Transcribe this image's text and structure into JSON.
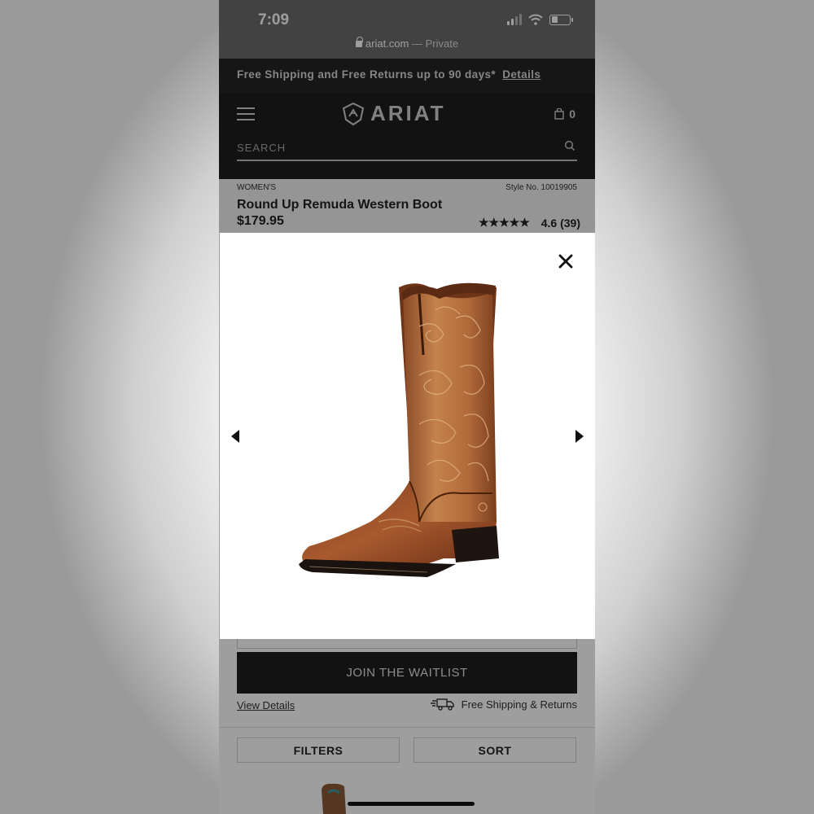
{
  "status_bar": {
    "time": "7:09",
    "url": "ariat.com",
    "url_suffix": "— Private"
  },
  "promo_bar": {
    "text": "Free Shipping and Free Returns up to 90 days*",
    "link": "Details"
  },
  "header": {
    "brand": "ARIAT",
    "cart_count": "0",
    "search_placeholder": "SEARCH"
  },
  "product": {
    "category": "WOMEN'S",
    "style_no": "Style No. 10019905",
    "name": "Round Up Remuda Western Boot",
    "price": "$179.95",
    "stars": "★★★★★",
    "rating": "4.6 (39)"
  },
  "actions": {
    "waitlist": "JOIN THE WAITLIST",
    "view_details": "View Details",
    "shipping": "Free Shipping & Returns",
    "filters": "FILTERS",
    "sort": "SORT"
  },
  "modal": {
    "image_alt": "brown-western-boot",
    "close_icon": "close-icon",
    "prev_icon": "arrow-left-icon",
    "next_icon": "arrow-right-icon"
  }
}
